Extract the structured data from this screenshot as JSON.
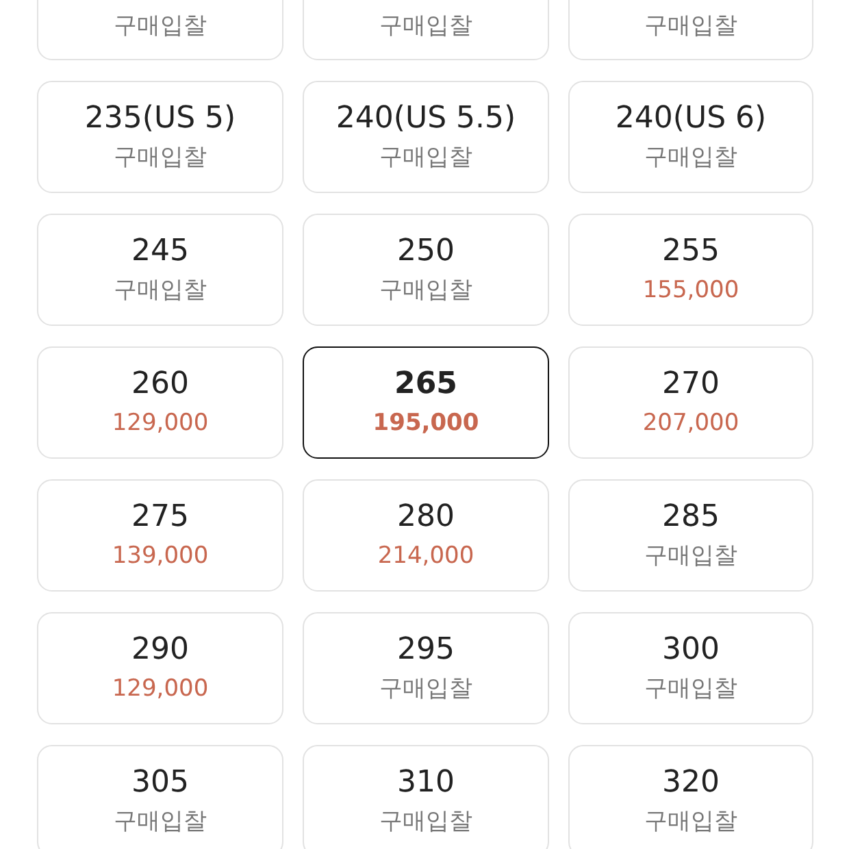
{
  "sizes": [
    {
      "price": "구매입찰",
      "kind": "bid",
      "selected": false
    },
    {
      "price": "구매입찰",
      "kind": "bid",
      "selected": false
    },
    {
      "price": "구매입찰",
      "kind": "bid",
      "selected": false
    },
    {
      "size": "235(US 5)",
      "price": "구매입찰",
      "kind": "bid",
      "selected": false
    },
    {
      "size": "240(US 5.5)",
      "price": "구매입찰",
      "kind": "bid",
      "selected": false
    },
    {
      "size": "240(US 6)",
      "price": "구매입찰",
      "kind": "bid",
      "selected": false
    },
    {
      "size": "245",
      "price": "구매입찰",
      "kind": "bid",
      "selected": false
    },
    {
      "size": "250",
      "price": "구매입찰",
      "kind": "bid",
      "selected": false
    },
    {
      "size": "255",
      "price": "155,000",
      "kind": "price",
      "selected": false
    },
    {
      "size": "260",
      "price": "129,000",
      "kind": "price",
      "selected": false
    },
    {
      "size": "265",
      "price": "195,000",
      "kind": "price",
      "selected": true
    },
    {
      "size": "270",
      "price": "207,000",
      "kind": "price",
      "selected": false
    },
    {
      "size": "275",
      "price": "139,000",
      "kind": "price",
      "selected": false
    },
    {
      "size": "280",
      "price": "214,000",
      "kind": "price",
      "selected": false
    },
    {
      "size": "285",
      "price": "구매입찰",
      "kind": "bid",
      "selected": false
    },
    {
      "size": "290",
      "price": "129,000",
      "kind": "price",
      "selected": false
    },
    {
      "size": "295",
      "price": "구매입찰",
      "kind": "bid",
      "selected": false
    },
    {
      "size": "300",
      "price": "구매입찰",
      "kind": "bid",
      "selected": false
    },
    {
      "size": "305",
      "price": "구매입찰",
      "kind": "bid",
      "selected": false
    },
    {
      "size": "310",
      "price": "구매입찰",
      "kind": "bid",
      "selected": false
    },
    {
      "size": "320",
      "price": "구매입찰",
      "kind": "bid",
      "selected": false
    }
  ]
}
